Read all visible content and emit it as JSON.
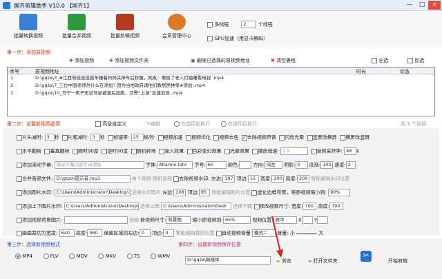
{
  "window": {
    "title": "国齐剪辑助手 V10.0  【国齐1】",
    "min": "—",
    "max": "□",
    "close": "×"
  },
  "toolbar": {
    "batch_convert": "批量转换视频",
    "batch_merge": "批量合并视频",
    "batch_edit": "批量剪辑视频",
    "member": "会员管理中心",
    "multithread_label": "多线程",
    "thread_count": "2",
    "thread_unit": "个线程",
    "gpu_label": "GPU加速（用显卡解码）"
  },
  "step1": {
    "title": "第一步：添加原视频",
    "add_video": "添加视频",
    "add_folder": "添加视频文件夹",
    "delete_selected": "删除已选择的原视频地址",
    "clear_table": "清空表格",
    "select_all": "全选",
    "invert": "反选"
  },
  "list": {
    "columns": [
      "序号",
      "原视频地址",
      "时长",
      "状态"
    ],
    "rows": [
      {
        "index": "1",
        "path": "D:\\gqzx\\3_#江西萌娃坐摇摇车睡着妈妈关掉车后秒醒，网友：像极了老人打瞌睡看电视 .mp4"
      },
      {
        "index": "2",
        "path": "D:\\gqzx\\7_三位中国老师为什么在添加? 因为当地政府请他们教居民种菜#添加 .mp4"
      },
      {
        "index": "3",
        "path": "D:\\gqzx\\10_万宁一男子无证驾驶被查后逃跑，交警“上演”急速追逐 .mp4"
      }
    ],
    "count": "共 3 个视频"
  },
  "step2": {
    "title": "第二步：设置新视频选项",
    "advanced": "高级自定义",
    "edit": "编辑",
    "before_label": "在选项前执行",
    "after_label": "在选项后执行"
  },
  "opt": {
    "head_trim": "片头减时:",
    "head_val": "3",
    "sec": "秒",
    "tail_trim": "片尾减时:",
    "tail_val": "3",
    "frame_rate": "帧速率:",
    "frame_val": "25",
    "fps_unit": "帧/秒",
    "video_speed": "视频加速",
    "video_optimize": "视频优化",
    "video_color": "视频去色",
    "remove_audio": "去除视频声音",
    "flash": "闪烁光晕",
    "vertical_crop": "竖屏改横屏",
    "horizontal_crop": "横屏改竖屏",
    "hflip": "水平翻转",
    "vflip": "垂直翻转",
    "rot90": "顺时90度",
    "rot90b": "逆时90度",
    "random_convert": "随机转场",
    "fade": "渐入效果",
    "color_shift": "色彩变幻效果",
    "light": "光晕效果",
    "play_speed": "播放倍速:",
    "play_speed_val": "0.5",
    "sample_rate": "音频采样率:",
    "sample_val": "48",
    "sample_unit": "k",
    "scroll_sub": "添加滚动字幕:",
    "scroll_placeholder": "滚动字幕内容手动添加",
    "font": "字体:",
    "font_val": "Aharoni (ahr",
    "font_size": "字号:",
    "size_val": "60",
    "color": "颜色:",
    "direction": "方向:",
    "dir_val": "向左",
    "shadow": "阴影:",
    "shadow_val": "0",
    "bottom": "底部:",
    "bottom_val": "100",
    "speed": "速度:",
    "speed_val": "2",
    "merge_audio": "合并音频文件:",
    "merge_audio_val": "D:\\gqzx\\提示音.mp3",
    "single_audio": "单个音频",
    "random_audio": "随机音频",
    "remove_wm": "去除视频水印:",
    "left": "左边:",
    "left_val": "197",
    "top": "顶边:",
    "top_val": "15",
    "width": "宽度:",
    "width_val": "200",
    "height": "高度:",
    "height_val": "200",
    "smart_wm": "智能编辑水印位置",
    "add_img_wm": "添加图片水印:",
    "img_wm_path": "C:\\Users\\Administrator\\Desktop\\111.j",
    "choose_wm": "选择水印图片",
    "left2": "左边:",
    "left2_val": "208",
    "top2": "顶边:",
    "top2_val": "85",
    "smart_img": "智能编辑图片位置",
    "blur_bg": "虚化边框背景，将原视频缩小到:",
    "blur_val": "90%",
    "add_frame": "添加上下图片水印:",
    "frame_path": "C:\\Users\\Administrator\\Desktop\\g",
    "choose_top": "选择上图",
    "frame_path2": "C:\\Users\\Administrator\\Desk",
    "choose_bottom": "选择下图",
    "modify_size": "修改视频尺寸:",
    "width2": "宽度:",
    "width2_val": "700",
    "height2": "高度:",
    "height2_val": "700",
    "add_bg": "添加视频背景图片:",
    "bg_pick": "选图",
    "new_pos": "新视频尺寸:",
    "new_pos_val": "背景图",
    "shrink": "缩小原视频到:",
    "shrink_val": "95%",
    "video_pos": "视频位置:",
    "video_pos_val": "居中",
    "xy": "X",
    "y": "Y",
    "crop": "画面裁切为宽度:",
    "crop_w": "640",
    "crop_h_label": "高度:",
    "crop_h": "360",
    "keep_left": "保留区域的左边:",
    "keep_left_val": "0",
    "keep_top": "顶边:",
    "keep_top_val": "0",
    "smart_crop": "智能编辑裁剪位置",
    "auto_volume": "自动视频音量",
    "mode": "模式二",
    "volume": "音量:",
    "vol_small": "小",
    "vol_big": "大"
  },
  "step3": {
    "title": "第三步：选择新视频格式",
    "formats": [
      "MP4",
      "FLV",
      "MOV",
      "MKV",
      "TS",
      "WMV"
    ]
  },
  "step4": {
    "title": "第四步：设置新视频保存位置",
    "path": "D:\\gqzx\\新媒体",
    "browse": "浏览",
    "open_folder": "打开文件夹",
    "start": "开始剪辑"
  }
}
